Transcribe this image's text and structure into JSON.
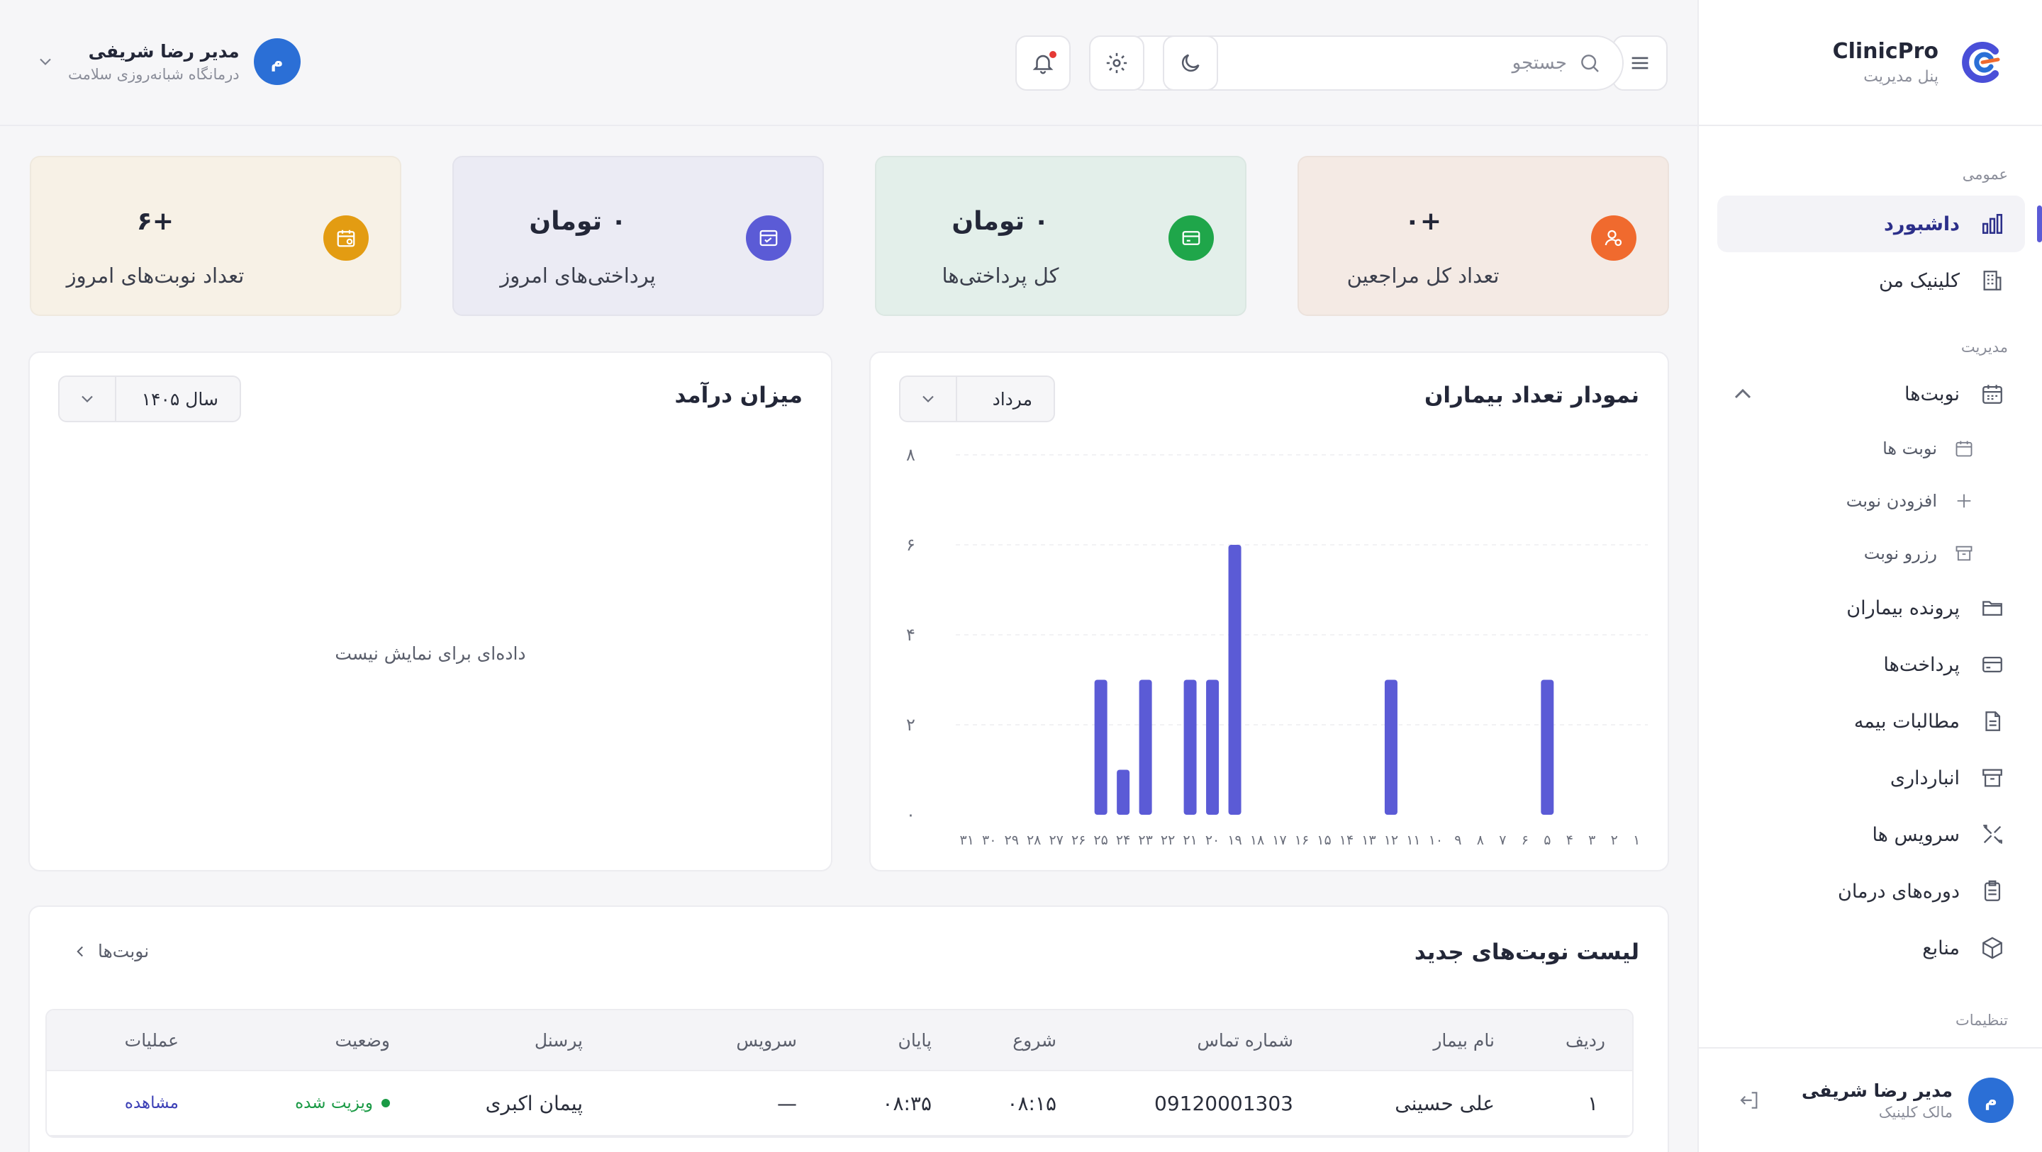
{
  "brand": {
    "name": "ClinicPro",
    "subtitle": "پنل مدیریت"
  },
  "sidebar": {
    "section_general": "عمومی",
    "section_management": "مدیریت",
    "section_settings": "تنظیمات",
    "items": [
      {
        "label": "داشبورد",
        "icon": "bar-chart-icon"
      },
      {
        "label": "کلینیک من",
        "icon": "building-icon"
      },
      {
        "label": "نوبت‌ها",
        "icon": "calendar-icon"
      },
      {
        "label": "نوبت ها",
        "icon": "calendar-small-icon"
      },
      {
        "label": "افزودن نوبت",
        "icon": "plus-icon"
      },
      {
        "label": "رزرو نوبت",
        "icon": "archive-icon"
      },
      {
        "label": "پرونده بیماران",
        "icon": "folder-icon"
      },
      {
        "label": "پرداخت‌ها",
        "icon": "credit-card-icon"
      },
      {
        "label": "مطالبات بیمه",
        "icon": "document-icon"
      },
      {
        "label": "انبارداری",
        "icon": "archive-box-icon"
      },
      {
        "label": "سرویس ها",
        "icon": "tools-icon"
      },
      {
        "label": "دوره‌های درمان",
        "icon": "clipboard-icon"
      },
      {
        "label": "منابع",
        "icon": "cube-icon"
      }
    ],
    "user": {
      "name": "مدیر رضا شریفی",
      "role": "مالک کلینیک",
      "initial": "م"
    }
  },
  "topbar": {
    "search_placeholder": "جستجو",
    "user": {
      "name": "مدیر رضا شریفی",
      "clinic": "درمانگاه شبانه‌روزی سلامت",
      "initial": "م"
    }
  },
  "stats": [
    {
      "value": "+۰",
      "label": "تعداد کل مراجعین",
      "color": "#f4eae4",
      "icon_color": "#f06a2e",
      "icon": "user-icon"
    },
    {
      "value": "۰ تومان",
      "label": "کل پرداختی‌ها",
      "color": "#e3efea",
      "icon_color": "#1fa64a",
      "icon": "wallet-icon"
    },
    {
      "value": "۰ تومان",
      "label": "پرداختی‌های امروز",
      "color": "#ebebf4",
      "icon_color": "#5b5bd6",
      "icon": "receipt-icon"
    },
    {
      "value": "+۶",
      "label": "تعداد نوبت‌های امروز",
      "color": "#f7f1e6",
      "icon_color": "#e39c12",
      "icon": "calendar-check-icon"
    }
  ],
  "patients_chart": {
    "title": "نمودار تعداد بیماران",
    "month": "مرداد"
  },
  "income_chart": {
    "title": "میزان درآمد",
    "year": "سال ۱۴۰۵",
    "empty_text": "داده‌ای برای نمایش نیست"
  },
  "chart_data": {
    "type": "bar",
    "title": "نمودار تعداد بیماران",
    "categories": [
      "۱",
      "۲",
      "۳",
      "۴",
      "۵",
      "۶",
      "۷",
      "۸",
      "۹",
      "۱۰",
      "۱۱",
      "۱۲",
      "۱۳",
      "۱۴",
      "۱۵",
      "۱۶",
      "۱۷",
      "۱۸",
      "۱۹",
      "۲۰",
      "۲۱",
      "۲۲",
      "۲۳",
      "۲۴",
      "۲۵",
      "۲۶",
      "۲۷",
      "۲۸",
      "۲۹",
      "۳۰",
      "۳۱"
    ],
    "values": [
      0,
      0,
      0,
      0,
      3,
      0,
      0,
      0,
      0,
      0,
      0,
      3,
      0,
      0,
      0,
      0,
      0,
      0,
      6,
      3,
      3,
      0,
      3,
      1,
      3,
      0,
      0,
      0,
      0,
      0,
      0
    ],
    "yticks": [
      "۰",
      "۲",
      "۴",
      "۶",
      "۸"
    ],
    "ylim": [
      0,
      8
    ],
    "color": "#5b5bd6",
    "grid": true
  },
  "appointments": {
    "title": "لیست نوبت‌های جدید",
    "link": "نوبت‌ها",
    "columns": [
      "ردیف",
      "نام بیمار",
      "شماره تماس",
      "شروع",
      "پایان",
      "سرویس",
      "پرسنل",
      "وضعیت",
      "عملیات"
    ],
    "rows": [
      {
        "index": "۱",
        "patient": "علی حسینی",
        "phone": "09120001303",
        "start": "۰۸:۱۵",
        "end": "۰۸:۳۵",
        "service": "—",
        "staff": "پیمان اکبری",
        "status": "ویزیت شده",
        "action": "مشاهده"
      }
    ]
  }
}
